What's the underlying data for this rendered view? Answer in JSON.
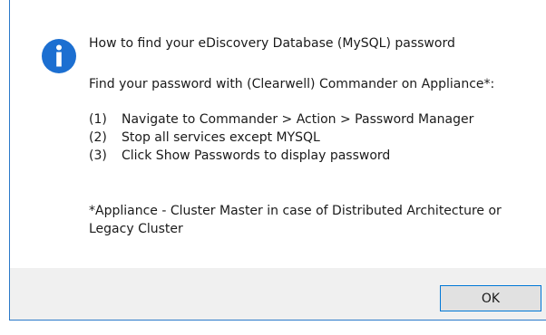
{
  "dialog": {
    "heading": "How to find your eDiscovery Database (MySQL) password",
    "intro": "Find your password with (Clearwell) Commander on Appliance*:",
    "steps": [
      {
        "num": "(1)",
        "text": "Navigate to Commander > Action > Password Manager"
      },
      {
        "num": "(2)",
        "text": "Stop all services except MYSQL"
      },
      {
        "num": "(3)",
        "text": "Click Show Passwords to display password"
      }
    ],
    "footnote_line1": "*Appliance - Cluster Master in case of Distributed Architecture or",
    "footnote_line2": "Legacy Cluster",
    "icon": "info-icon",
    "ok_label": "OK"
  },
  "colors": {
    "icon_blue": "#1c6fd1",
    "frame_blue": "#2b79c9",
    "footer_bg": "#f0f0f0",
    "button_border": "#0078d7"
  }
}
